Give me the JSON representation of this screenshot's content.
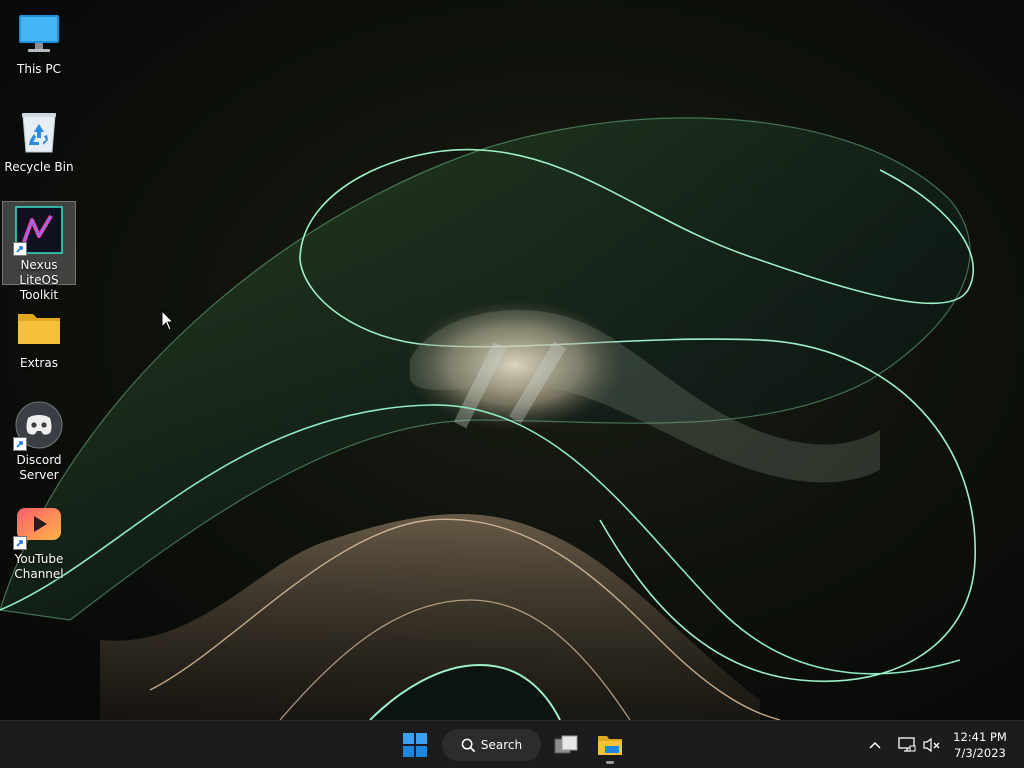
{
  "desktop": {
    "icons": [
      {
        "label": "This PC",
        "icon": "monitor-icon"
      },
      {
        "label": "Recycle Bin",
        "icon": "recycle-bin-icon"
      },
      {
        "label": "Nexus LiteOS Toolkit",
        "icon": "nexus-toolkit-icon",
        "shortcut": true,
        "selected": true
      },
      {
        "label": "Extras",
        "icon": "folder-icon"
      },
      {
        "label": "Discord Server",
        "icon": "discord-icon",
        "shortcut": true
      },
      {
        "label": "YouTube Channel",
        "icon": "youtube-icon",
        "shortcut": true
      }
    ]
  },
  "taskbar": {
    "search_label": "Search",
    "clock_time": "12:41 PM",
    "clock_date": "7/3/2023",
    "accent": "#0078d4"
  },
  "colors": {
    "wallpaper_line": "#9ff0c8",
    "taskbar_bg": "#1c1c1c",
    "folder_yellow": "#f5c13a"
  }
}
